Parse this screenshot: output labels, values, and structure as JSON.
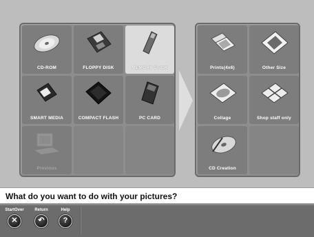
{
  "sources": {
    "tiles": [
      {
        "label": "CD-ROM",
        "icon": "cd-rom-icon"
      },
      {
        "label": "FLOPPY DISK",
        "icon": "floppy-disk-icon"
      },
      {
        "label": "MEMORY STICK",
        "icon": "memory-stick-icon",
        "selected": true
      },
      {
        "label": "SMART MEDIA",
        "icon": "smart-media-icon"
      },
      {
        "label": "COMPACT FLASH",
        "icon": "compact-flash-icon"
      },
      {
        "label": "PC CARD",
        "icon": "pc-card-icon"
      },
      {
        "label": "Previous",
        "icon": "computer-icon",
        "disabled": true
      }
    ]
  },
  "outputs": {
    "tiles": [
      {
        "label": "Prints(4x6)",
        "icon": "prints-icon"
      },
      {
        "label": "Other Size",
        "icon": "other-size-icon"
      },
      {
        "label": "Collage",
        "icon": "collage-icon"
      },
      {
        "label": "Shop staff only",
        "icon": "shop-staff-icon"
      },
      {
        "label": "CD Creation",
        "icon": "cd-creation-icon"
      }
    ]
  },
  "prompt": {
    "text": "What do you want to do with your pictures?"
  },
  "footer": {
    "startover_label": "StartOver",
    "return_label": "Return",
    "help_label": "Help",
    "startover_glyph": "✕",
    "return_glyph": "↶",
    "help_glyph": "?"
  },
  "colors": {
    "panel": "#8e8e8e",
    "tile": "#7d7d7d",
    "selected_tile": "#dcdcdc",
    "footer": "#6c6c6c"
  }
}
